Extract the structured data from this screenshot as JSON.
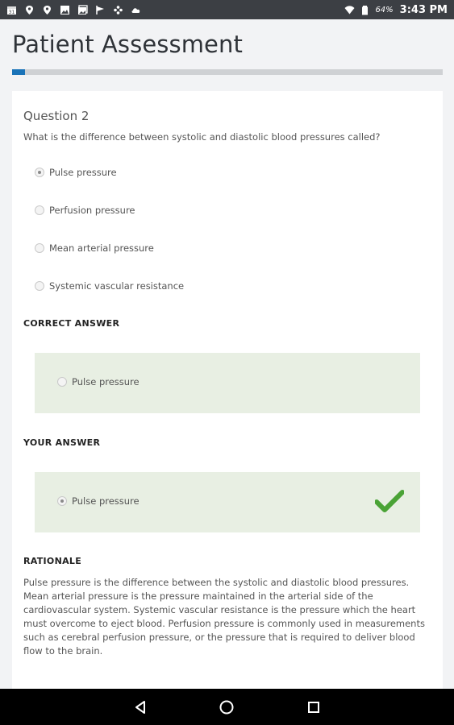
{
  "status_bar": {
    "left_icons": [
      "calendar-icon",
      "location-icon",
      "location-icon",
      "image-icon",
      "gallery-icon",
      "flag-icon",
      "dots-icon",
      "cloud-icon"
    ],
    "right_icons": [
      "wifi-icon",
      "battery-icon"
    ],
    "battery": "64%",
    "time": "3:43 PM"
  },
  "header": {
    "title": "Patient Assessment",
    "progress": 0.03,
    "colors": {
      "progress_fill": "#1a73b8",
      "progress_track": "#cfd1d4"
    }
  },
  "question": {
    "number_label": "Question 2",
    "text": "What is the difference between systolic and diastolic blood pressures called?",
    "options": [
      {
        "label": "Pulse pressure",
        "selected": true
      },
      {
        "label": "Perfusion pressure",
        "selected": false
      },
      {
        "label": "Mean arterial pressure",
        "selected": false
      },
      {
        "label": "Systemic vascular resistance",
        "selected": false
      }
    ]
  },
  "correct_answer": {
    "heading": "CORRECT ANSWER",
    "option_label": "Pulse pressure"
  },
  "your_answer": {
    "heading": "YOUR ANSWER",
    "option_label": "Pulse pressure",
    "status_icon": "checkmark-icon",
    "status_color": "#4aa336"
  },
  "rationale": {
    "heading": "RATIONALE",
    "text": "Pulse pressure is the difference between the systolic and diastolic blood pressures. Mean arterial pressure is the pressure maintained in the arterial side of the cardiovascular system. Systemic vascular resistance is the pressure which the heart must overcome to eject blood. Perfusion pressure is commonly used in measurements such as cerebral perfusion pressure, or the pressure that is required to deliver blood flow to the brain."
  },
  "nav_bar": {
    "buttons": [
      "back-icon",
      "home-icon",
      "recents-icon"
    ]
  }
}
